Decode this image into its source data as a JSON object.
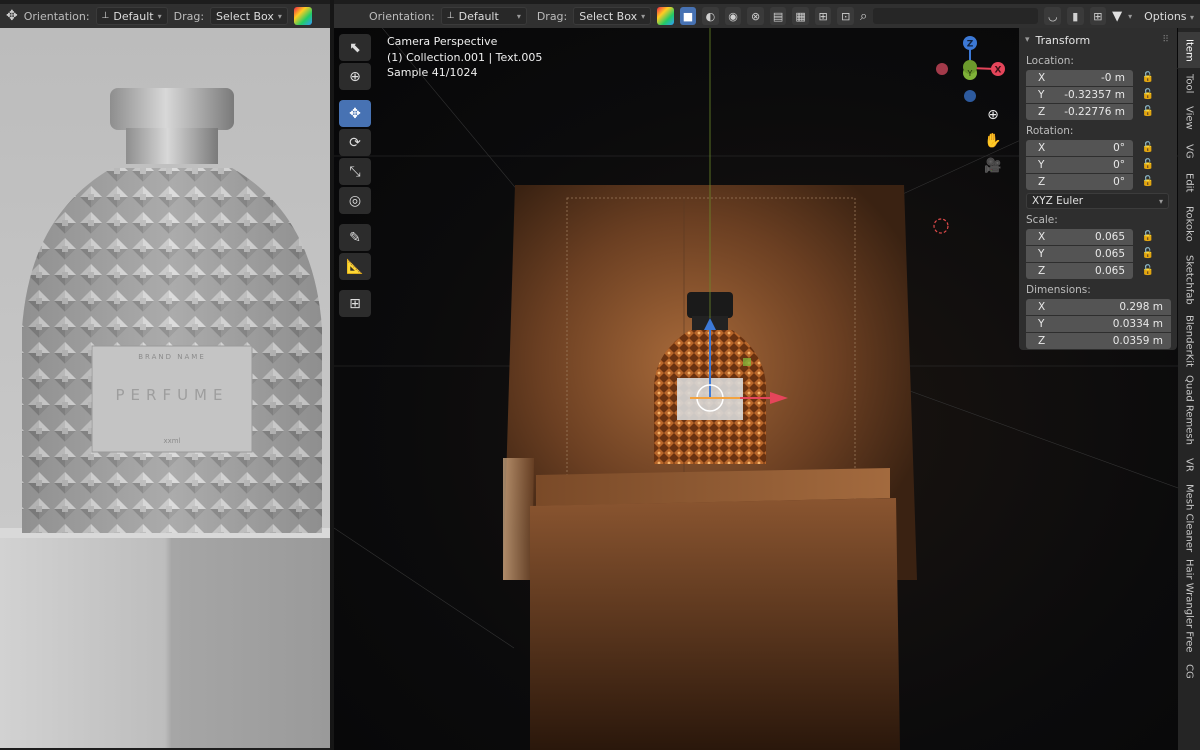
{
  "left_header": {
    "orientation_label": "Orientation:",
    "orientation_value": "Default",
    "drag_label": "Drag:",
    "drag_value": "Select Box"
  },
  "left_label": {
    "brand": "BRAND NAME",
    "product": "PERFUME",
    "volume": "xxml"
  },
  "right_header": {
    "orientation_label": "Orientation:",
    "orientation_value": "Default",
    "drag_label": "Drag:",
    "drag_value": "Select Box",
    "options_label": "Options"
  },
  "viewport_info": {
    "line1": "Camera Perspective",
    "line2": "(1) Collection.001 | Text.005",
    "line3": "Sample 41/1024"
  },
  "gizmo": {
    "z": "Z",
    "y": "Y",
    "x": "X"
  },
  "transform": {
    "title": "Transform",
    "location_label": "Location:",
    "location": [
      {
        "axis": "X",
        "value": "-0 m"
      },
      {
        "axis": "Y",
        "value": "-0.32357 m"
      },
      {
        "axis": "Z",
        "value": "-0.22776 m"
      }
    ],
    "rotation_label": "Rotation:",
    "rotation": [
      {
        "axis": "X",
        "value": "0°"
      },
      {
        "axis": "Y",
        "value": "0°"
      },
      {
        "axis": "Z",
        "value": "0°"
      }
    ],
    "rotation_mode": "XYZ Euler",
    "scale_label": "Scale:",
    "scale": [
      {
        "axis": "X",
        "value": "0.065"
      },
      {
        "axis": "Y",
        "value": "0.065"
      },
      {
        "axis": "Z",
        "value": "0.065"
      }
    ],
    "dimensions_label": "Dimensions:",
    "dimensions": [
      {
        "axis": "X",
        "value": "0.298 m"
      },
      {
        "axis": "Y",
        "value": "0.0334 m"
      },
      {
        "axis": "Z",
        "value": "0.0359 m"
      }
    ]
  },
  "tabs": [
    "Item",
    "Tool",
    "View",
    "VG",
    "Edit",
    "Rokoko",
    "Sketchfab",
    "BlenderKit",
    "Quad Remesh",
    "VR",
    "Mesh Cleaner",
    "Hair Wrangler Free",
    "CG"
  ],
  "colors": {
    "accent": "#4772b3",
    "x_axis": "#e5455a",
    "y_axis": "#7fb238",
    "z_axis": "#3c79d6"
  }
}
